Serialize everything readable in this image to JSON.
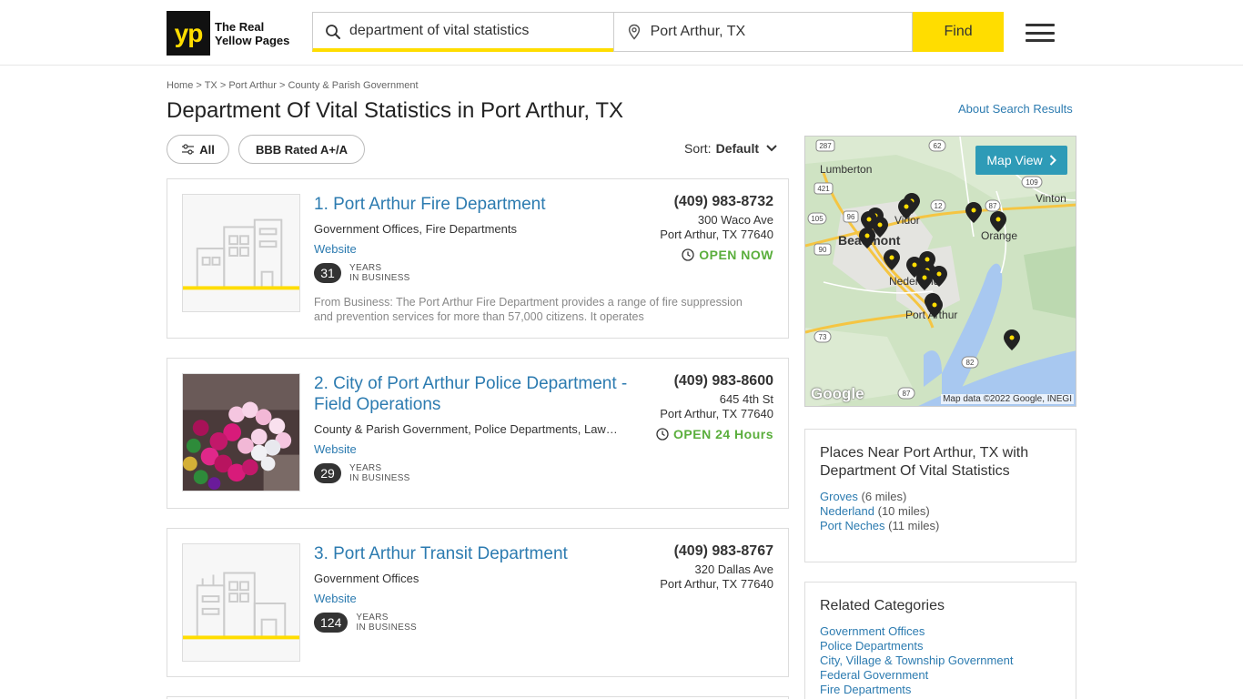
{
  "logo": {
    "mark": "yp",
    "line1": "The Real",
    "line2": "Yellow Pages"
  },
  "search": {
    "what_value": "department of vital statistics",
    "where_value": "Port Arthur, TX",
    "find_label": "Find"
  },
  "breadcrumb": {
    "home": "Home",
    "sep": ">",
    "state": "TX",
    "city": "Port Arthur",
    "category": "County & Parish Government"
  },
  "page_title": "Department Of Vital Statistics in Port Arthur, TX",
  "about_link": "About Search Results",
  "filters": {
    "all": "All",
    "bbb": "BBB Rated A+/A"
  },
  "sort": {
    "label": "Sort:",
    "value": "Default"
  },
  "results": [
    {
      "name": "1. Port Arthur Fire Department",
      "categories": "Government Offices, Fire Departments",
      "website": "Website",
      "years": "31",
      "years_label_1": "YEARS",
      "years_label_2": "IN BUSINESS",
      "phone": "(409) 983-8732",
      "street": "300 Waco Ave",
      "city": "Port Arthur, TX 77640",
      "open": "OPEN NOW",
      "snippet": "From Business: The Port Arthur Fire Department provides a range of fire suppression and prevention services for more than 57,000 citizens. It operates"
    },
    {
      "name_line1": "2. City of Port Arthur Police Department -",
      "name_line2": "Field Operations",
      "categories": "County & Parish Government, Police Departments, Law…",
      "website": "Website",
      "years": "29",
      "years_label_1": "YEARS",
      "years_label_2": "IN BUSINESS",
      "phone": "(409) 983-8600",
      "street": "645 4th St",
      "city": "Port Arthur, TX 77640",
      "open": "OPEN 24 Hours"
    },
    {
      "name": "3. Port Arthur Transit Department",
      "categories": "Government Offices",
      "website": "Website",
      "years": "124",
      "years_label_1": "YEARS",
      "years_label_2": "IN BUSINESS",
      "phone": "(409) 983-8767",
      "street": "320 Dallas Ave",
      "city": "Port Arthur, TX 77640"
    }
  ],
  "map": {
    "button": "Map View",
    "credit": "Map data ©2022 Google, INEGI",
    "google": "Google",
    "labels": {
      "lumberton": "Lumberton",
      "vidor": "Vidor",
      "vinton": "Vinton",
      "orange": "Orange",
      "beaumont": "Beaumont",
      "nederland": "Nederland",
      "port_arthur": "Port Arthur"
    },
    "shields": {
      "s287": "287",
      "s62": "62",
      "s421": "421",
      "s105": "105",
      "s96": "96",
      "s12": "12",
      "s90": "90",
      "s87a": "87",
      "s109": "109",
      "s73": "73",
      "s82": "82",
      "s87b": "87"
    }
  },
  "places_near": {
    "title_line1": "Places Near Port Arthur, TX with",
    "title_line2": "Department Of Vital Statistics",
    "items": [
      {
        "name": "Groves",
        "dist": "(6 miles)"
      },
      {
        "name": "Nederland",
        "dist": "(10 miles)"
      },
      {
        "name": "Port Neches",
        "dist": "(11 miles)"
      }
    ]
  },
  "related": {
    "title": "Related Categories",
    "items": [
      "Government Offices",
      "Police Departments",
      "City, Village & Township Government",
      "Federal Government",
      "Fire Departments"
    ]
  },
  "colors": {
    "brand_yellow": "#ffdd00",
    "link_blue": "#2c7bb0",
    "open_green": "#5aae3c",
    "map_button": "#2e9bb7"
  }
}
